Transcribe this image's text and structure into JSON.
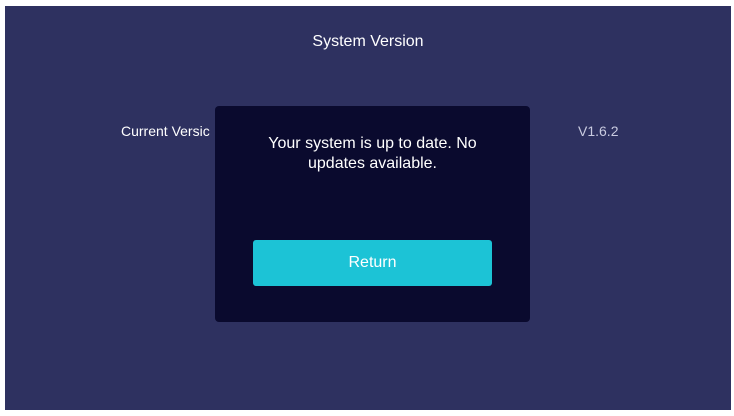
{
  "screen": {
    "title": "System Version",
    "background_color": "#2e3160"
  },
  "info_row": {
    "label": "Current Versic",
    "value": "V1.6.2"
  },
  "dialog": {
    "message": "Your system is up to date. No updates available.",
    "background_color": "#0a0a2e",
    "return_button_label": "Return",
    "button_color": "#1cc3d6"
  }
}
